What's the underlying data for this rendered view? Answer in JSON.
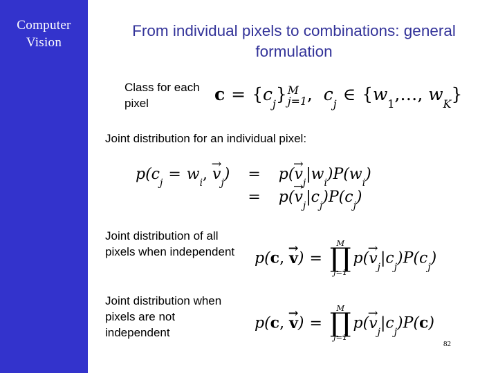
{
  "slide": {
    "sidebar": {
      "brand_line1": "Computer",
      "brand_line2": "Vision",
      "background_color": "#3333cc",
      "text_color": "#ffffff"
    },
    "title": "From individual pixels to combinations: general formulation",
    "title_color": "#333399",
    "page_number": "82",
    "labels": {
      "class_for_each_pixel": "Class for each pixel",
      "joint_single_pixel": "Joint distribution for an individual pixel:",
      "joint_all_independent": "Joint distribution of all pixels when independent",
      "joint_not_independent": "Joint distribution when pixels are not independent"
    },
    "formulas": {
      "class": {
        "plain": "c = {c_j}_{j=1}^{M},  c_j ∈ {w_1, …, w_K}",
        "vector_c": "c",
        "equals": "=",
        "open_brace": "{",
        "close_brace": "}",
        "element": "c",
        "index": "j",
        "upper_limit": "M",
        "lower_limit": "j=1",
        "comma": ",",
        "member_symbol": "∈",
        "class_first": "w",
        "class_first_index": "1",
        "ellipsis": ", … ,",
        "class_last": "w",
        "class_last_index": "K"
      },
      "joint_single": {
        "plain_line1": "p(c_j = w_i, v⃗_j)  =  p(v⃗_j|w_i) P(w_i)",
        "plain_line2": "=  p(v⃗_j|c_j) P(c_j)",
        "line1": {
          "lhs": "p(c_j = w_i, v_j)",
          "relation": "=",
          "rhs": "p(v_j|w_i)P(w_i)"
        },
        "line2": {
          "lhs": "",
          "relation": "=",
          "rhs": "p(v_j|c_j)P(c_j)"
        }
      },
      "joint_independent": {
        "plain": "p(c, v⃗) = ∏_{j=1}^{M} p(v⃗_j|c_j) P(c_j)",
        "lhs": "p(c, v)",
        "equals": "=",
        "product_symbol": "∏",
        "upper_limit": "M",
        "lower_limit": "j=1",
        "rhs": "p(v_j|c_j)P(c_j)"
      },
      "joint_dependent": {
        "plain": "p(c, v⃗) = ∏_{j=1}^{M} p(v⃗_j|c_j) P(c)",
        "lhs": "p(c, v)",
        "equals": "=",
        "product_symbol": "∏",
        "upper_limit": "M",
        "lower_limit": "j=1",
        "rhs": "p(v_j|c_j)P(c)"
      }
    }
  }
}
